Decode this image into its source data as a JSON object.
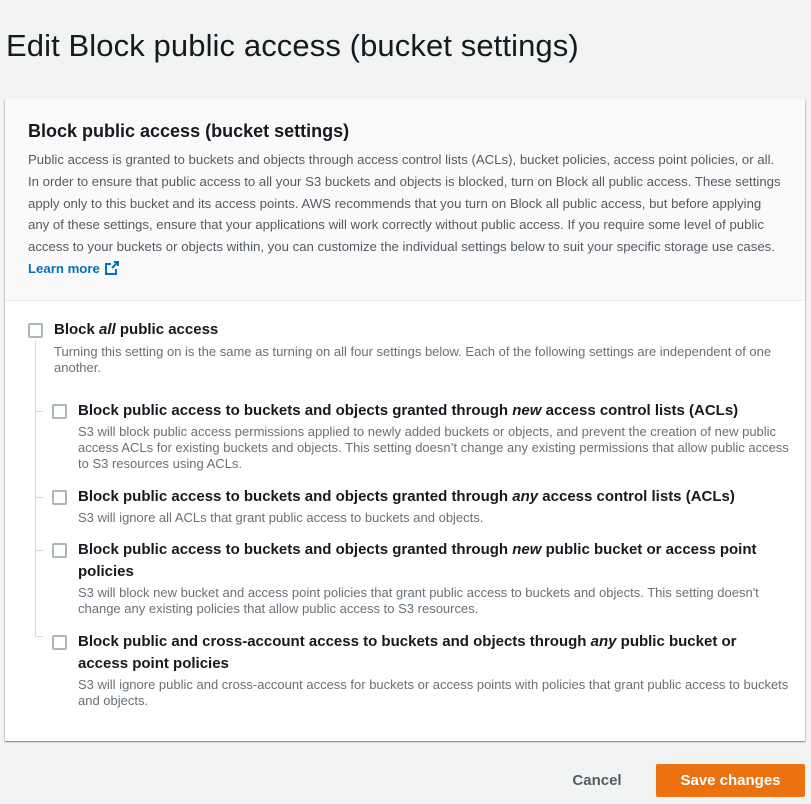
{
  "page": {
    "title": "Edit Block public access (bucket settings)"
  },
  "panel": {
    "title": "Block public access (bucket settings)",
    "description": "Public access is granted to buckets and objects through access control lists (ACLs), bucket policies, access point policies, or all. In order to ensure that public access to all your S3 buckets and objects is blocked, turn on Block all public access. These settings apply only to this bucket and its access points. AWS recommends that you turn on Block all public access, but before applying any of these settings, ensure that your applications will work correctly without public access. If you require some level of public access to your buckets or objects within, you can customize the individual settings below to suit your specific storage use cases.",
    "learn_more": "Learn more"
  },
  "block_all": {
    "title_pre": "Block ",
    "title_em": "all",
    "title_post": " public access",
    "description": "Turning this setting on is the same as turning on all four settings below. Each of the following settings are independent of one another.",
    "checked": false
  },
  "options": [
    {
      "title_pre": "Block public access to buckets and objects granted through ",
      "title_em": "new",
      "title_post": " access control lists (ACLs)",
      "description": "S3 will block public access permissions applied to newly added buckets or objects, and prevent the creation of new public access ACLs for existing buckets and objects. This setting doesn’t change any existing permissions that allow public access to S3 resources using ACLs.",
      "checked": false
    },
    {
      "title_pre": "Block public access to buckets and objects granted through ",
      "title_em": "any",
      "title_post": " access control lists (ACLs)",
      "description": "S3 will ignore all ACLs that grant public access to buckets and objects.",
      "checked": false
    },
    {
      "title_pre": "Block public access to buckets and objects granted through ",
      "title_em": "new",
      "title_post": " public bucket or access point policies",
      "description": "S3 will block new bucket and access point policies that grant public access to buckets and objects. This setting doesn't change any existing policies that allow public access to S3 resources.",
      "checked": false
    },
    {
      "title_pre": "Block public and cross-account access to buckets and objects through ",
      "title_em": "any",
      "title_post": " public bucket or access point policies",
      "description": "S3 will ignore public and cross-account access for buckets or access points with policies that grant public access to buckets and objects.",
      "checked": false
    }
  ],
  "actions": {
    "cancel": "Cancel",
    "save": "Save changes"
  },
  "colors": {
    "primary": "#ec7211",
    "link": "#0073bb",
    "background": "#f2f3f3"
  }
}
